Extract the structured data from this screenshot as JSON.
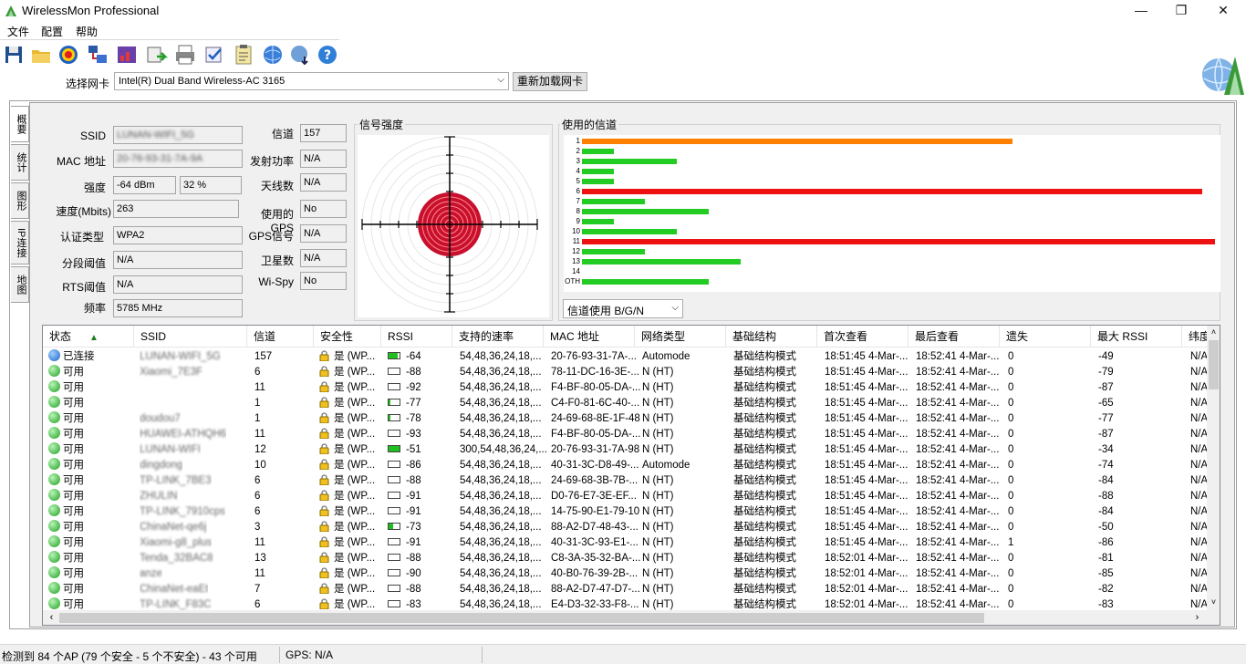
{
  "window": {
    "title": "WirelessMon Professional",
    "minimize": "—",
    "maximize": "❐",
    "close": "✕"
  },
  "menu": [
    "文件",
    "配置",
    "帮助"
  ],
  "adapter": {
    "label": "选择网卡",
    "value": "Intel(R) Dual Band Wireless-AC 3165",
    "reload_label": "重新加载网卡"
  },
  "side_tabs": [
    "概要",
    "统计",
    "图形",
    "IP连接",
    "地图"
  ],
  "info": {
    "ssid_label": "SSID",
    "ssid_value": "LUNAN-WIFI_5G",
    "mac_label": "MAC 地址",
    "mac_value": "20-76-93-31-7A-9A",
    "strength_label": "强度",
    "strength_dbm": "-64 dBm",
    "strength_pct": "32 %",
    "speed_label": "速度(Mbits)",
    "speed_value": "263",
    "auth_label": "认证类型",
    "auth_value": "WPA2",
    "frag_label": "分段阈值",
    "frag_value": "N/A",
    "rts_label": "RTS阈值",
    "rts_value": "N/A",
    "freq_label": "频率",
    "freq_value": "5785 MHz",
    "channel_label": "信道",
    "channel_value": "157",
    "txpower_label": "发射功率",
    "txpower_value": "N/A",
    "antenna_label": "天线数",
    "antenna_value": "N/A",
    "gps_used_label": "使用的GPS",
    "gps_used_value": "No",
    "gps_signal_label": "GPS信号",
    "gps_signal_value": "N/A",
    "satellites_label": "卫星数",
    "satellites_value": "N/A",
    "wispy_label": "Wi-Spy",
    "wispy_value": "No"
  },
  "signal_group_title": "信号强度",
  "channel_group_title": "使用的信道",
  "channel_chart": {
    "labels": [
      "1",
      "2",
      "3",
      "4",
      "5",
      "6",
      "7",
      "8",
      "9",
      "10",
      "11",
      "12",
      "13",
      "14",
      "OTH"
    ],
    "values": [
      0.68,
      0.05,
      0.15,
      0.05,
      0.05,
      0.98,
      0.1,
      0.2,
      0.05,
      0.15,
      1.0,
      0.1,
      0.25,
      0,
      0.2
    ],
    "colors": [
      "#ff8000",
      "#22cc22",
      "#22cc22",
      "#22cc22",
      "#22cc22",
      "#ee1111",
      "#22cc22",
      "#22cc22",
      "#22cc22",
      "#22cc22",
      "#ee1111",
      "#22cc22",
      "#22cc22",
      "#22cc22",
      "#22cc22"
    ],
    "mode": "信道使用 B/G/N"
  },
  "table": {
    "headers": [
      "状态",
      "SSID",
      "信道",
      "安全性",
      "RSSI",
      "支持的速率",
      "MAC 地址",
      "网络类型",
      "基础结构",
      "首次查看",
      "最后查看",
      "遗失",
      "最大 RSSI",
      "纬度"
    ],
    "rows": [
      {
        "status": "已连接",
        "color": "blue",
        "ssid": "LUNAN-WIFI_5G",
        "ch": "157",
        "sec": "是 (WP...",
        "rssi": "-64",
        "level": 0.8,
        "rates": "54,48,36,24,18,...",
        "mac": "20-76-93-31-7A-...",
        "type": "Automode",
        "infra": "基础结构模式",
        "first": "18:51:45 4-Mar-...",
        "last": "18:52:41 4-Mar-...",
        "lost": "0",
        "max": "-49",
        "lat": "N/A"
      },
      {
        "status": "可用",
        "color": "green",
        "ssid": "Xiaomi_7E3F",
        "ch": "6",
        "sec": "是 (WP...",
        "rssi": "-88",
        "level": 0,
        "rates": "54,48,36,24,18,...",
        "mac": "78-11-DC-16-3E-...",
        "type": "N (HT)",
        "infra": "基础结构模式",
        "first": "18:51:45 4-Mar-...",
        "last": "18:52:41 4-Mar-...",
        "lost": "0",
        "max": "-79",
        "lat": "N/A"
      },
      {
        "status": "可用",
        "color": "green",
        "ssid": "",
        "ch": "11",
        "sec": "是 (WP...",
        "rssi": "-92",
        "level": 0,
        "rates": "54,48,36,24,18,...",
        "mac": "F4-BF-80-05-DA-...",
        "type": "N (HT)",
        "infra": "基础结构模式",
        "first": "18:51:45 4-Mar-...",
        "last": "18:52:41 4-Mar-...",
        "lost": "0",
        "max": "-87",
        "lat": "N/A"
      },
      {
        "status": "可用",
        "color": "green",
        "ssid": "",
        "ch": "1",
        "sec": "是 (WP...",
        "rssi": "-77",
        "level": 0.15,
        "rates": "54,48,36,24,18,...",
        "mac": "C4-F0-81-6C-40-...",
        "type": "N (HT)",
        "infra": "基础结构模式",
        "first": "18:51:45 4-Mar-...",
        "last": "18:52:41 4-Mar-...",
        "lost": "0",
        "max": "-65",
        "lat": "N/A"
      },
      {
        "status": "可用",
        "color": "green",
        "ssid": "doudou7",
        "ch": "1",
        "sec": "是 (WP...",
        "rssi": "-78",
        "level": 0.15,
        "rates": "54,48,36,24,18,...",
        "mac": "24-69-68-8E-1F-48",
        "type": "N (HT)",
        "infra": "基础结构模式",
        "first": "18:51:45 4-Mar-...",
        "last": "18:52:41 4-Mar-...",
        "lost": "0",
        "max": "-77",
        "lat": "N/A"
      },
      {
        "status": "可用",
        "color": "green",
        "ssid": "HUAWEI-ATHQH6",
        "ch": "11",
        "sec": "是 (WP...",
        "rssi": "-93",
        "level": 0,
        "rates": "54,48,36,24,18,...",
        "mac": "F4-BF-80-05-DA-...",
        "type": "N (HT)",
        "infra": "基础结构模式",
        "first": "18:51:45 4-Mar-...",
        "last": "18:52:41 4-Mar-...",
        "lost": "0",
        "max": "-87",
        "lat": "N/A"
      },
      {
        "status": "可用",
        "color": "green",
        "ssid": "LUNAN-WIFI",
        "ch": "12",
        "sec": "是 (WP...",
        "rssi": "-51",
        "level": 1,
        "rates": "300,54,48,36,24,...",
        "mac": "20-76-93-31-7A-98",
        "type": "N (HT)",
        "infra": "基础结构模式",
        "first": "18:51:45 4-Mar-...",
        "last": "18:52:41 4-Mar-...",
        "lost": "0",
        "max": "-34",
        "lat": "N/A"
      },
      {
        "status": "可用",
        "color": "green",
        "ssid": "dingdong",
        "ch": "10",
        "sec": "是 (WP...",
        "rssi": "-86",
        "level": 0,
        "rates": "54,48,36,24,18,...",
        "mac": "40-31-3C-D8-49-...",
        "type": "Automode",
        "infra": "基础结构模式",
        "first": "18:51:45 4-Mar-...",
        "last": "18:52:41 4-Mar-...",
        "lost": "0",
        "max": "-74",
        "lat": "N/A"
      },
      {
        "status": "可用",
        "color": "green",
        "ssid": "TP-LINK_7BE3",
        "ch": "6",
        "sec": "是 (WP...",
        "rssi": "-88",
        "level": 0,
        "rates": "54,48,36,24,18,...",
        "mac": "24-69-68-3B-7B-...",
        "type": "N (HT)",
        "infra": "基础结构模式",
        "first": "18:51:45 4-Mar-...",
        "last": "18:52:41 4-Mar-...",
        "lost": "0",
        "max": "-84",
        "lat": "N/A"
      },
      {
        "status": "可用",
        "color": "green",
        "ssid": "ZHULIN",
        "ch": "6",
        "sec": "是 (WP...",
        "rssi": "-91",
        "level": 0,
        "rates": "54,48,36,24,18,...",
        "mac": "D0-76-E7-3E-EF...",
        "type": "N (HT)",
        "infra": "基础结构模式",
        "first": "18:51:45 4-Mar-...",
        "last": "18:52:41 4-Mar-...",
        "lost": "0",
        "max": "-88",
        "lat": "N/A"
      },
      {
        "status": "可用",
        "color": "green",
        "ssid": "TP-LINK_7910cps",
        "ch": "6",
        "sec": "是 (WP...",
        "rssi": "-91",
        "level": 0,
        "rates": "54,48,36,24,18,...",
        "mac": "14-75-90-E1-79-10",
        "type": "N (HT)",
        "infra": "基础结构模式",
        "first": "18:51:45 4-Mar-...",
        "last": "18:52:41 4-Mar-...",
        "lost": "0",
        "max": "-84",
        "lat": "N/A"
      },
      {
        "status": "可用",
        "color": "green",
        "ssid": "ChinaNet-qe6j",
        "ch": "3",
        "sec": "是 (WP...",
        "rssi": "-73",
        "level": 0.45,
        "rates": "54,48,36,24,18,...",
        "mac": "88-A2-D7-48-43-...",
        "type": "N (HT)",
        "infra": "基础结构模式",
        "first": "18:51:45 4-Mar-...",
        "last": "18:52:41 4-Mar-...",
        "lost": "0",
        "max": "-50",
        "lat": "N/A"
      },
      {
        "status": "可用",
        "color": "green",
        "ssid": "Xiaomi-g8_plus",
        "ch": "11",
        "sec": "是 (WP...",
        "rssi": "-91",
        "level": 0,
        "rates": "54,48,36,24,18,...",
        "mac": "40-31-3C-93-E1-...",
        "type": "N (HT)",
        "infra": "基础结构模式",
        "first": "18:51:45 4-Mar-...",
        "last": "18:52:41 4-Mar-...",
        "lost": "1",
        "max": "-86",
        "lat": "N/A"
      },
      {
        "status": "可用",
        "color": "green",
        "ssid": "Tenda_32BAC8",
        "ch": "13",
        "sec": "是 (WP...",
        "rssi": "-88",
        "level": 0,
        "rates": "54,48,36,24,18,...",
        "mac": "C8-3A-35-32-BA-...",
        "type": "N (HT)",
        "infra": "基础结构模式",
        "first": "18:52:01 4-Mar-...",
        "last": "18:52:41 4-Mar-...",
        "lost": "0",
        "max": "-81",
        "lat": "N/A"
      },
      {
        "status": "可用",
        "color": "green",
        "ssid": "anze",
        "ch": "11",
        "sec": "是 (WP...",
        "rssi": "-90",
        "level": 0,
        "rates": "54,48,36,24,18,...",
        "mac": "40-B0-76-39-2B-...",
        "type": "N (HT)",
        "infra": "基础结构模式",
        "first": "18:52:01 4-Mar-...",
        "last": "18:52:41 4-Mar-...",
        "lost": "0",
        "max": "-85",
        "lat": "N/A"
      },
      {
        "status": "可用",
        "color": "green",
        "ssid": "ChinaNet-eaEt",
        "ch": "7",
        "sec": "是 (WP...",
        "rssi": "-88",
        "level": 0,
        "rates": "54,48,36,24,18,...",
        "mac": "88-A2-D7-47-D7-...",
        "type": "N (HT)",
        "infra": "基础结构模式",
        "first": "18:52:01 4-Mar-...",
        "last": "18:52:41 4-Mar-...",
        "lost": "0",
        "max": "-82",
        "lat": "N/A"
      },
      {
        "status": "可用",
        "color": "green",
        "ssid": "TP-LINK_F83C",
        "ch": "6",
        "sec": "是 (WP...",
        "rssi": "-83",
        "level": 0,
        "rates": "54,48,36,24,18,...",
        "mac": "E4-D3-32-33-F8-...",
        "type": "N (HT)",
        "infra": "基础结构模式",
        "first": "18:52:01 4-Mar-...",
        "last": "18:52:41 4-Mar-...",
        "lost": "0",
        "max": "-83",
        "lat": "N/A"
      }
    ]
  },
  "statusbar": {
    "ap_count": "检测到 84 个AP (79 个安全 - 5 个不安全) - 43 个可用",
    "gps": "GPS: N/A"
  }
}
